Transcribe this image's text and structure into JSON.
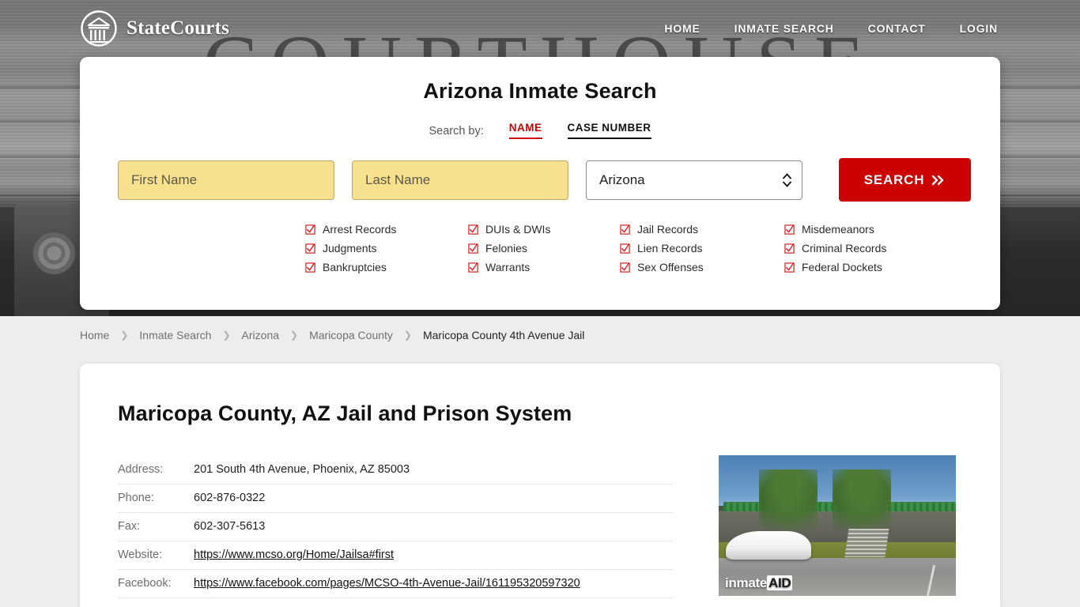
{
  "header": {
    "brand_name": "StateCourts",
    "logo_icon": "courthouse-circle-icon",
    "nav": [
      {
        "label": "HOME"
      },
      {
        "label": "INMATE SEARCH"
      },
      {
        "label": "CONTACT"
      },
      {
        "label": "LOGIN"
      }
    ]
  },
  "search_card": {
    "title": "Arizona Inmate Search",
    "search_by_label": "Search by:",
    "tabs": [
      {
        "label": "NAME",
        "active": true
      },
      {
        "label": "CASE NUMBER",
        "active": false
      }
    ],
    "first_name_placeholder": "First Name",
    "first_name_value": "",
    "last_name_placeholder": "Last Name",
    "last_name_value": "",
    "state_value": "Arizona",
    "state_options": [
      "Arizona"
    ],
    "search_button_label": "SEARCH",
    "search_button_icon": "double-chevron-right-icon",
    "record_types": [
      "Arrest Records",
      "DUIs & DWIs",
      "Jail Records",
      "Misdemeanors",
      "Judgments",
      "Felonies",
      "Lien Records",
      "Criminal Records",
      "Bankruptcies",
      "Warrants",
      "Sex Offenses",
      "Federal Dockets"
    ]
  },
  "breadcrumb": {
    "separator": "❯",
    "items": [
      {
        "label": "Home",
        "current": false
      },
      {
        "label": "Inmate Search",
        "current": false
      },
      {
        "label": "Arizona",
        "current": false
      },
      {
        "label": "Maricopa County",
        "current": false
      },
      {
        "label": "Maricopa County 4th Avenue Jail",
        "current": true
      }
    ]
  },
  "content": {
    "page_title": "Maricopa County, AZ Jail and Prison System",
    "details": [
      {
        "key": "Address:",
        "value": "201 South 4th Avenue, Phoenix, AZ 85003",
        "is_link": false
      },
      {
        "key": "Phone:",
        "value": "602-876-0322",
        "is_link": false
      },
      {
        "key": "Fax:",
        "value": "602-307-5613",
        "is_link": false
      },
      {
        "key": "Website:",
        "value": "https://www.mcso.org/Home/Jailsa#first",
        "is_link": true
      },
      {
        "key": "Facebook:",
        "value": "https://www.facebook.com/pages/MCSO-4th-Avenue-Jail/161195320597320",
        "is_link": true
      }
    ],
    "photo_watermark_prefix": "inmate",
    "photo_watermark_suffix": "AID"
  },
  "colors": {
    "accent_red": "#cc0000",
    "field_yellow": "#f7e08e",
    "page_background": "#ededed"
  }
}
